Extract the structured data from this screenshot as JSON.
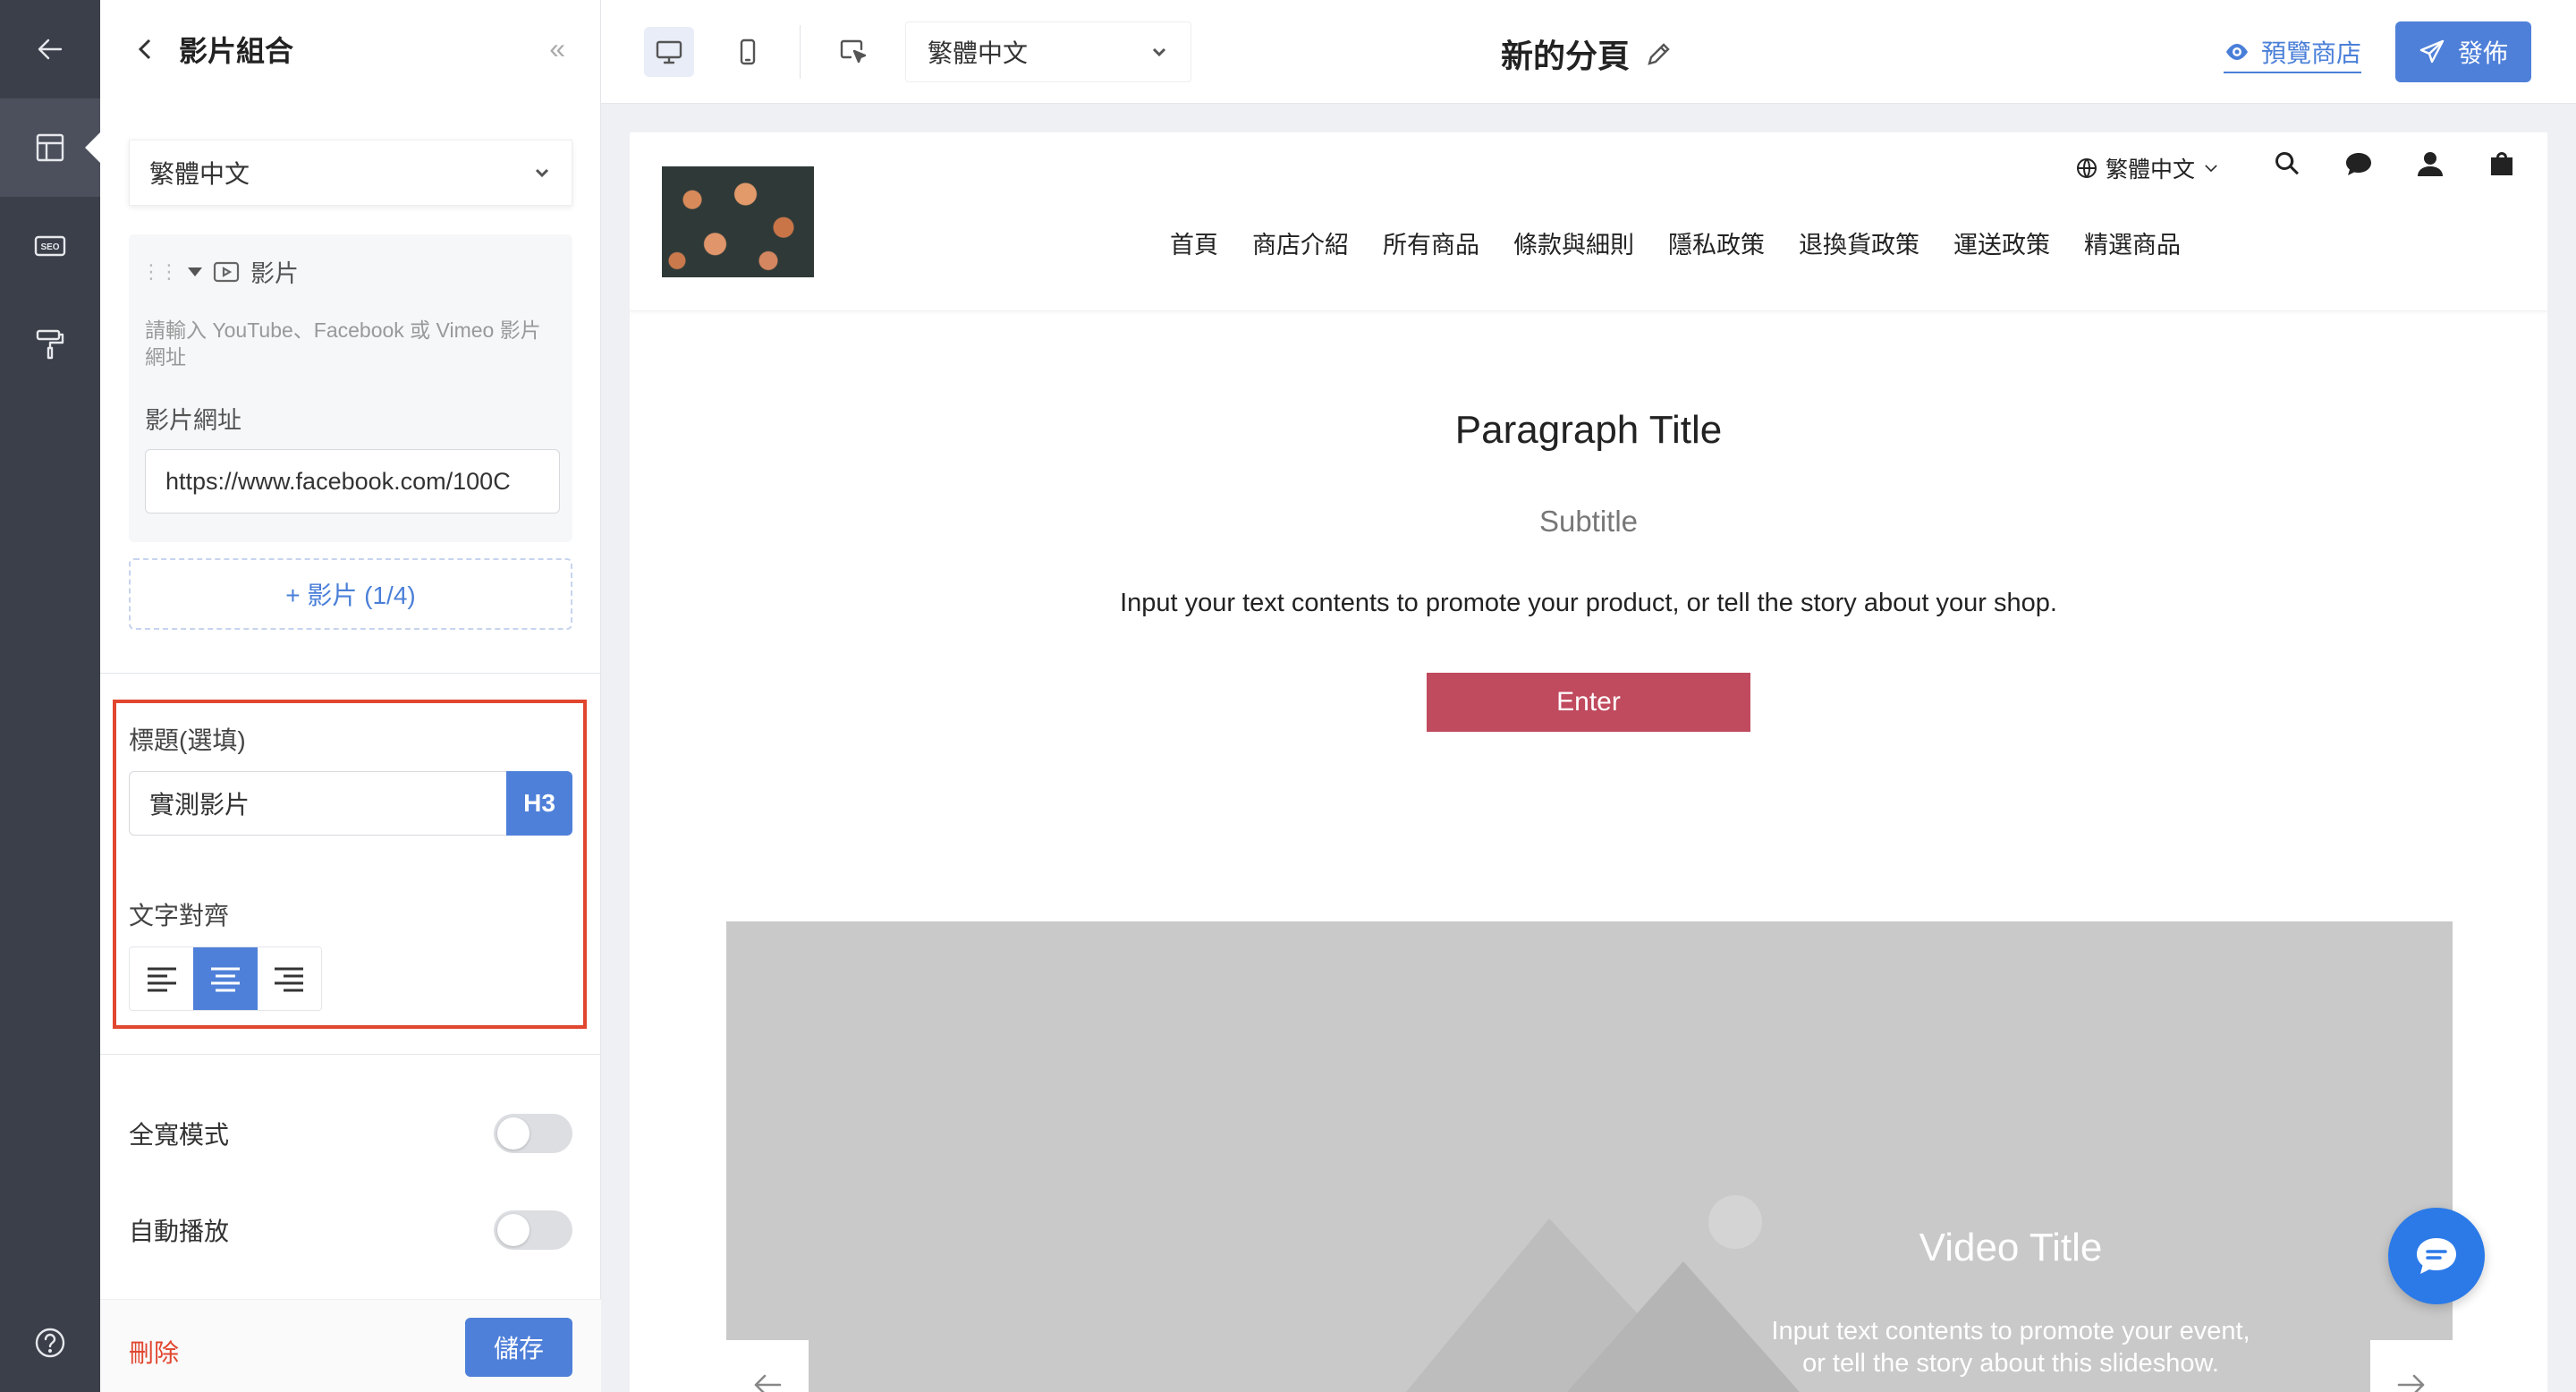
{
  "panel": {
    "title": "影片組合",
    "collapse_symbol": "«",
    "language": "繁體中文",
    "video_item": {
      "label": "影片",
      "hint": "請輸入 YouTube、Facebook 或 Vimeo 影片網址",
      "url_label": "影片網址",
      "url_value": "https://www.facebook.com/100C"
    },
    "add_video_label": "+ 影片 (1/4)",
    "heading_label": "標題(選填)",
    "heading_value": "實測影片",
    "heading_tag": "H3",
    "text_align_label": "文字對齊",
    "text_align_selected": "center",
    "full_width_label": "全寬模式",
    "full_width_on": false,
    "autoplay_label": "自動播放",
    "autoplay_on": false,
    "delete_label": "刪除",
    "save_label": "儲存"
  },
  "toolbar": {
    "language": "繁體中文",
    "page_name": "新的分頁",
    "preview_label": "預覽商店",
    "publish_label": "發佈"
  },
  "store": {
    "language": "繁體中文",
    "nav": [
      "首頁",
      "商店介紹",
      "所有商品",
      "條款與細則",
      "隱私政策",
      "退換貨政策",
      "運送政策",
      "精選商品"
    ],
    "paragraph": {
      "title": "Paragraph Title",
      "subtitle": "Subtitle",
      "body": "Input your text contents to promote your product, or tell the story about your shop.",
      "button": "Enter"
    },
    "slideshow": {
      "title": "Video Title",
      "desc_line1": "Input text contents to promote your event,",
      "desc_line2": "or tell the story about this slideshow."
    }
  },
  "colors": {
    "accent": "#4f80d9",
    "danger": "#e1462f",
    "enter_button": "#c04a5e",
    "rail": "#3b3f4a",
    "chat": "#2b7ae8"
  }
}
